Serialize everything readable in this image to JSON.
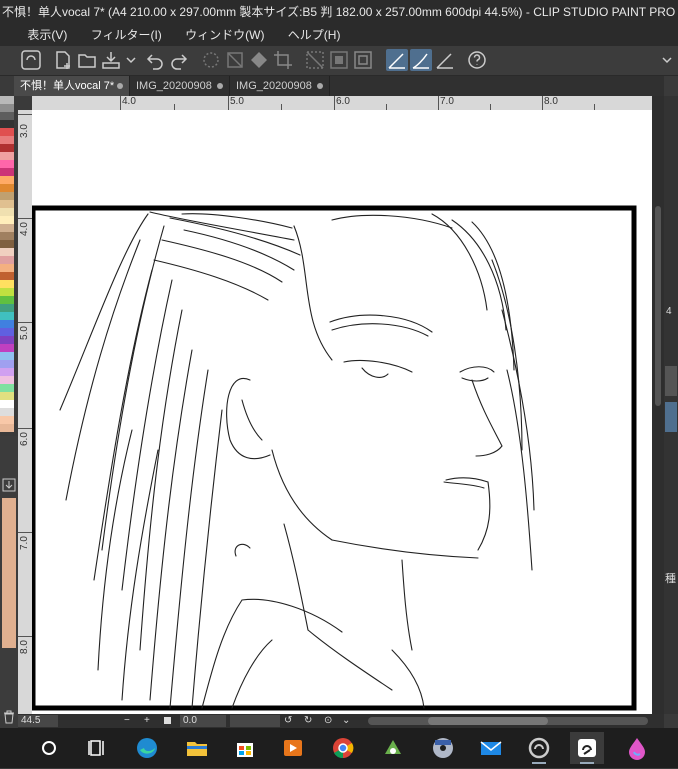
{
  "window": {
    "title": "不惧！单人vocal 7* (A4 210.00 x 297.00mm 製本サイズ:B5 判 182.00 x 257.00mm 600dpi 44.5%)  - CLIP STUDIO PAINT PRO"
  },
  "menu": {
    "items": [
      "表示(V)",
      "フィルター(I)",
      "ウィンドウ(W)",
      "ヘルプ(H)"
    ]
  },
  "tabs": [
    {
      "label": "不惧！单人vocal 7*",
      "active": true
    },
    {
      "label": "IMG_20200908",
      "active": false
    },
    {
      "label": "IMG_20200908",
      "active": false
    }
  ],
  "ruler": {
    "top_labels": [
      "4.0",
      "5.0",
      "6.0",
      "7.0",
      "8.0"
    ],
    "left_labels": [
      "3.0",
      "4.0",
      "5.0",
      "6.0",
      "7.0",
      "8.0"
    ]
  },
  "status": {
    "zoom": "44.5",
    "rotation": "0.0"
  },
  "right_panel_labels": [
    "4",
    "種"
  ],
  "colors": {
    "app_bg": "#3a3a3a",
    "titlebar": "#2b2b2b",
    "accent": "#4f6f8f",
    "canvas": "#ffffff",
    "taskbar": "#1e1e1e"
  },
  "taskbar_icons": [
    "start-icon",
    "task-view-icon",
    "edge-icon",
    "file-explorer-icon",
    "store-icon",
    "media-player-icon",
    "chrome-icon",
    "green-app-icon",
    "cd-burner-icon",
    "mail-icon",
    "clip-studio-icon",
    "clip-studio-paint-icon",
    "drop-paint-icon"
  ]
}
